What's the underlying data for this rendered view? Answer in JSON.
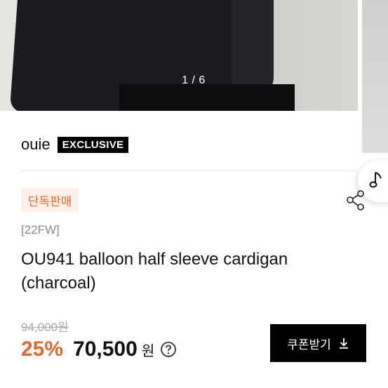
{
  "gallery": {
    "counter": "1 / 6"
  },
  "brand": {
    "name": "ouie",
    "tag": "EXCLUSIVE"
  },
  "product": {
    "badge": "단독판매",
    "season": "[22FW]",
    "title": "OU941 balloon half sleeve cardigan (charcoal)"
  },
  "price": {
    "original": "94,000원",
    "discount": "25%",
    "sale": "70,500",
    "currency": "원"
  },
  "coupon": {
    "label": "쿠폰받기"
  },
  "icons": {
    "music": "music-note-icon",
    "share": "share-icon",
    "help": "question-circle-icon",
    "download": "download-arrow-icon"
  },
  "colors": {
    "accent": "#e06a2a",
    "badge_bg": "#fdf0e8",
    "button": "#000000"
  }
}
